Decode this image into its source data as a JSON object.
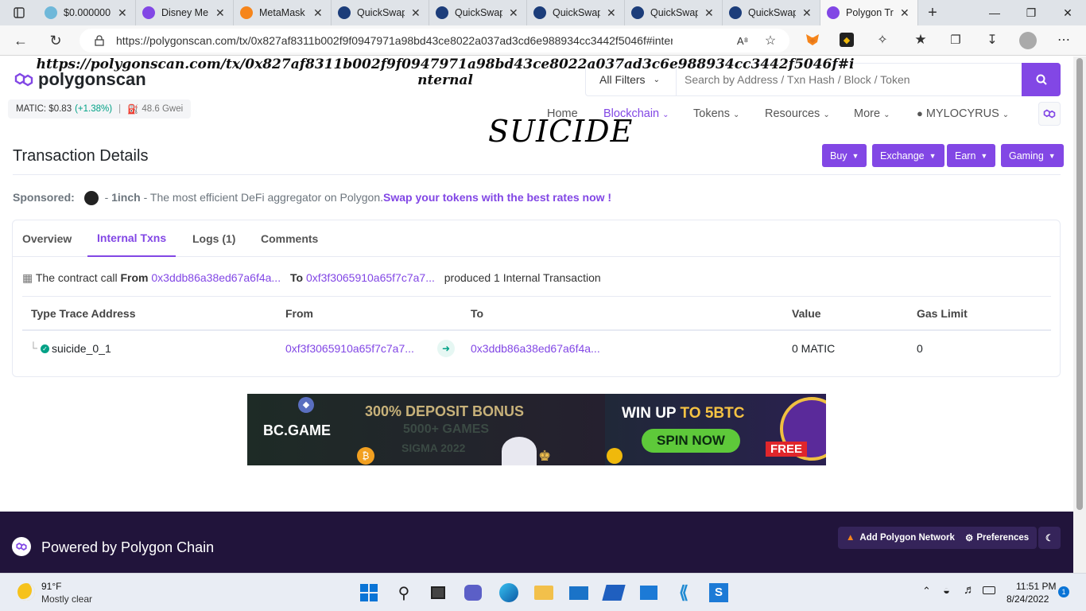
{
  "browser": {
    "tabs": [
      {
        "title": "$0.000000",
        "color": "#6fb8d9"
      },
      {
        "title": "Disney Me",
        "color": "#8247e5"
      },
      {
        "title": "MetaMask",
        "color": "#f6851b"
      },
      {
        "title": "QuickSwap",
        "color": "#1c3d7a"
      },
      {
        "title": "QuickSwap",
        "color": "#1c3d7a"
      },
      {
        "title": "QuickSwap",
        "color": "#1c3d7a"
      },
      {
        "title": "QuickSwap",
        "color": "#1c3d7a"
      },
      {
        "title": "QuickSwap",
        "color": "#1c3d7a"
      },
      {
        "title": "Polygon Tr",
        "color": "#8247e5"
      }
    ],
    "url": "https://polygonscan.com/tx/0x827af8311b002f9f0947971a98bd43ce8022a037ad3cd6e988934cc3442f5046f#internal"
  },
  "overlay": {
    "url_text": "https://polygonscan.com/tx/0x827af8311b002f9f0947971a98bd43ce8022a037ad3c6e988934cc3442f5046f#internal",
    "label": "SUICIDE"
  },
  "header": {
    "logo": "polygonscan",
    "matic_label": "MATIC: $0.83",
    "matic_change": "(+1.38%)",
    "gas": "48.6 Gwei",
    "filter": "All Filters",
    "search_placeholder": "Search by Address / Txn Hash / Block / Token",
    "nav": {
      "home": "Home",
      "blockchain": "Blockchain",
      "tokens": "Tokens",
      "resources": "Resources",
      "more": "More",
      "user": "MYLOCYRUS"
    }
  },
  "main": {
    "title": "Transaction Details",
    "buttons": {
      "buy": "Buy",
      "exchange": "Exchange",
      "earn": "Earn",
      "gaming": "Gaming"
    },
    "sponsored_label": "Sponsored:",
    "sponsor_name": "1inch",
    "sponsor_text": "- The most efficient DeFi aggregator on Polygon.",
    "sponsor_link": "Swap your tokens with the best rates now !",
    "tabs": {
      "overview": "Overview",
      "internal": "Internal Txns",
      "logs": "Logs (1)",
      "comments": "Comments"
    },
    "summary": {
      "prefix": "The contract call",
      "from_label": "From",
      "from": "0x3ddb86a38ed67a6f4a...",
      "to_label": "To",
      "to": "0xf3f3065910a65f7c7a7...",
      "suffix": "produced 1 Internal Transaction"
    },
    "table": {
      "headers": [
        "Type Trace Address",
        "From",
        "To",
        "Value",
        "Gas Limit"
      ],
      "row": {
        "type": "suicide_0_1",
        "from": "0xf3f3065910a65f7c7a7...",
        "to": "0x3ddb86a38ed67a6f4a...",
        "value": "0 MATIC",
        "gas": "0"
      }
    }
  },
  "ad": {
    "brand": "BC.GAME",
    "bonus": "300% DEPOSIT BONUS",
    "games": "5000+ GAMES",
    "sigma": "SIGMA 2022",
    "win": "WIN UP",
    "btc": "TO 5BTC",
    "spin": "SPIN NOW",
    "free": "FREE"
  },
  "footer": {
    "powered": "Powered by Polygon Chain",
    "add_network": "Add Polygon Network",
    "preferences": "Preferences"
  },
  "taskbar": {
    "temp": "91°F",
    "weather": "Mostly clear",
    "time": "11:51 PM",
    "date": "8/24/2022",
    "badge": "1"
  }
}
